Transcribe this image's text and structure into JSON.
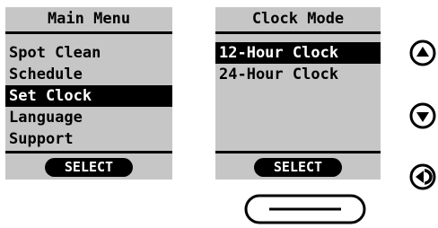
{
  "main_menu": {
    "title": "Main Menu",
    "items": [
      {
        "label": "Spot Clean"
      },
      {
        "label": "Schedule"
      },
      {
        "label": "Set Clock",
        "selected": true
      },
      {
        "label": "Language"
      },
      {
        "label": "Support"
      }
    ],
    "select_label": "SELECT"
  },
  "clock_mode": {
    "title": "Clock Mode",
    "items": [
      {
        "label": "12-Hour Clock",
        "selected": true
      },
      {
        "label": "24-Hour Clock"
      }
    ],
    "select_label": "SELECT"
  },
  "controls": {
    "up_icon": "arrow-up-circle-icon",
    "down_icon": "arrow-down-circle-icon",
    "back_icon": "back-arrow-circle-icon",
    "home_icon": "home-pill-button-icon"
  },
  "colors": {
    "screen_bg": "#c6c6c6",
    "ink": "#000000",
    "highlight_text": "#ffffff"
  }
}
